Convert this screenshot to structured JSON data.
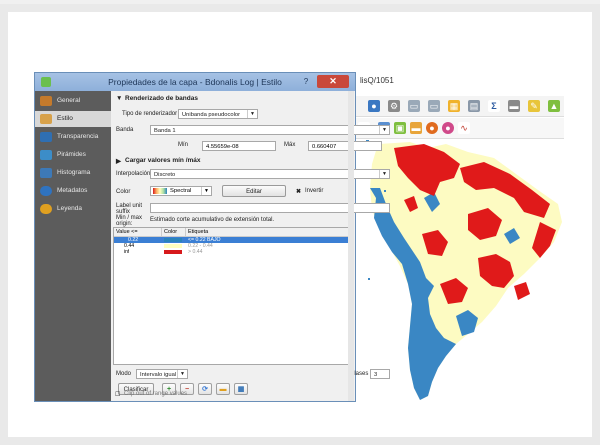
{
  "main_window": {
    "title_fragment": "lisQ/1051"
  },
  "dialog": {
    "title": "Propiedades de la capa - Bdonalis Log | Estilo",
    "help_label": "?",
    "close_label": "✕",
    "sidebar": [
      {
        "label": "General",
        "icon": "wrench-icon",
        "color": "#c47a2c",
        "active": false
      },
      {
        "label": "Estilo",
        "icon": "brush-icon",
        "color": "#d7a14a",
        "active": true
      },
      {
        "label": "Transparencia",
        "icon": "transparency-icon",
        "color": "#2f6fb3",
        "active": false
      },
      {
        "label": "Pirámides",
        "icon": "pyramid-icon",
        "color": "#3c8dc8",
        "active": false
      },
      {
        "label": "Histograma",
        "icon": "histogram-icon",
        "color": "#3d79b7",
        "active": false
      },
      {
        "label": "Metadatos",
        "icon": "info-icon",
        "color": "#2f73c0",
        "active": false
      },
      {
        "label": "Leyenda",
        "icon": "legend-icon",
        "color": "#e0a020",
        "active": false
      }
    ],
    "render": {
      "section_title": "Renderizado de bandas",
      "type_label": "Tipo de renderizador",
      "type_value": "Unibanda pseudocolor",
      "band_label": "Banda",
      "band_value": "Banda 1",
      "min_label": "Mín",
      "min_value": "4.55659e-08",
      "max_label": "Máx",
      "max_value": "0.660407",
      "load_section": "Cargar valores mín /máx",
      "interp_label": "Interpolación",
      "interp_value": "Discreto",
      "color_label": "Color",
      "ramp_value": "Spectral",
      "edit_label": "Editar",
      "invert_label": "Invertir",
      "unit_label": "Label unit suffix",
      "minmax_label": "Min / max origin:",
      "minmax_value": "Estimado corte acumulativo de extensión total."
    },
    "table": {
      "headers": [
        "Value <=",
        "Color",
        "Etiqueta"
      ],
      "rows": [
        {
          "value": "0.22",
          "color": "#2b83ba",
          "label": "<= 0.22 BAJO",
          "selected": true
        },
        {
          "value": "0.44",
          "color": "#ffffbf",
          "label": "0.22 - 0.44",
          "selected": false
        },
        {
          "value": "inf",
          "color": "#d7191c",
          "label": "> 0.44",
          "selected": false
        }
      ]
    },
    "mode_label": "Modo",
    "mode_value": "Intervalo igual",
    "classes_label": "Clases",
    "classes_value": "3",
    "classify_label": "Clasificar",
    "clip_label": "Clip out of range values"
  },
  "map_colors": {
    "high": "#e01a1a",
    "medium": "#fdfbc2",
    "low": "#3a87c4"
  }
}
